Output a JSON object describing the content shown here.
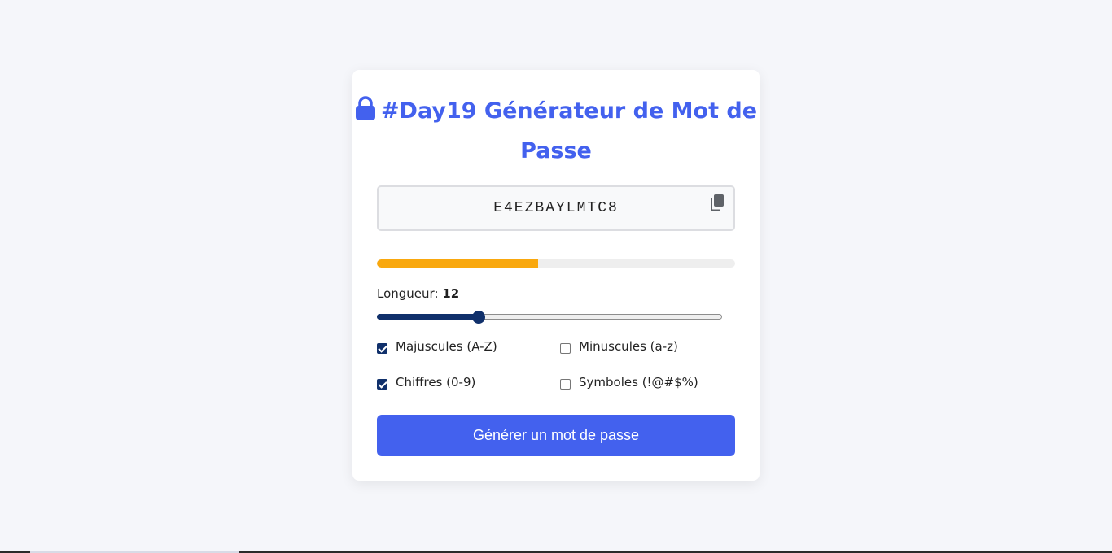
{
  "title": "#Day19 Générateur de Mot de Passe",
  "password": "E4EZBAYLMTC8",
  "strength": {
    "level": 0.45,
    "color": "#f9a80e"
  },
  "length": {
    "label": "Longueur:",
    "value": "12",
    "min": 4,
    "max": 32
  },
  "options": [
    {
      "label": "Majuscules (A-Z)",
      "checked": true
    },
    {
      "label": "Minuscules (a-z)",
      "checked": false
    },
    {
      "label": "Chiffres (0-9)",
      "checked": true
    },
    {
      "label": "Symboles (!@#$%)",
      "checked": false
    }
  ],
  "generate_button": "Générer un mot de passe",
  "icons": {
    "title": "lock-icon",
    "copy": "copy-icon"
  },
  "colors": {
    "accent": "#4361ee",
    "slider": "#10306b",
    "background": "#f5f6fa"
  }
}
